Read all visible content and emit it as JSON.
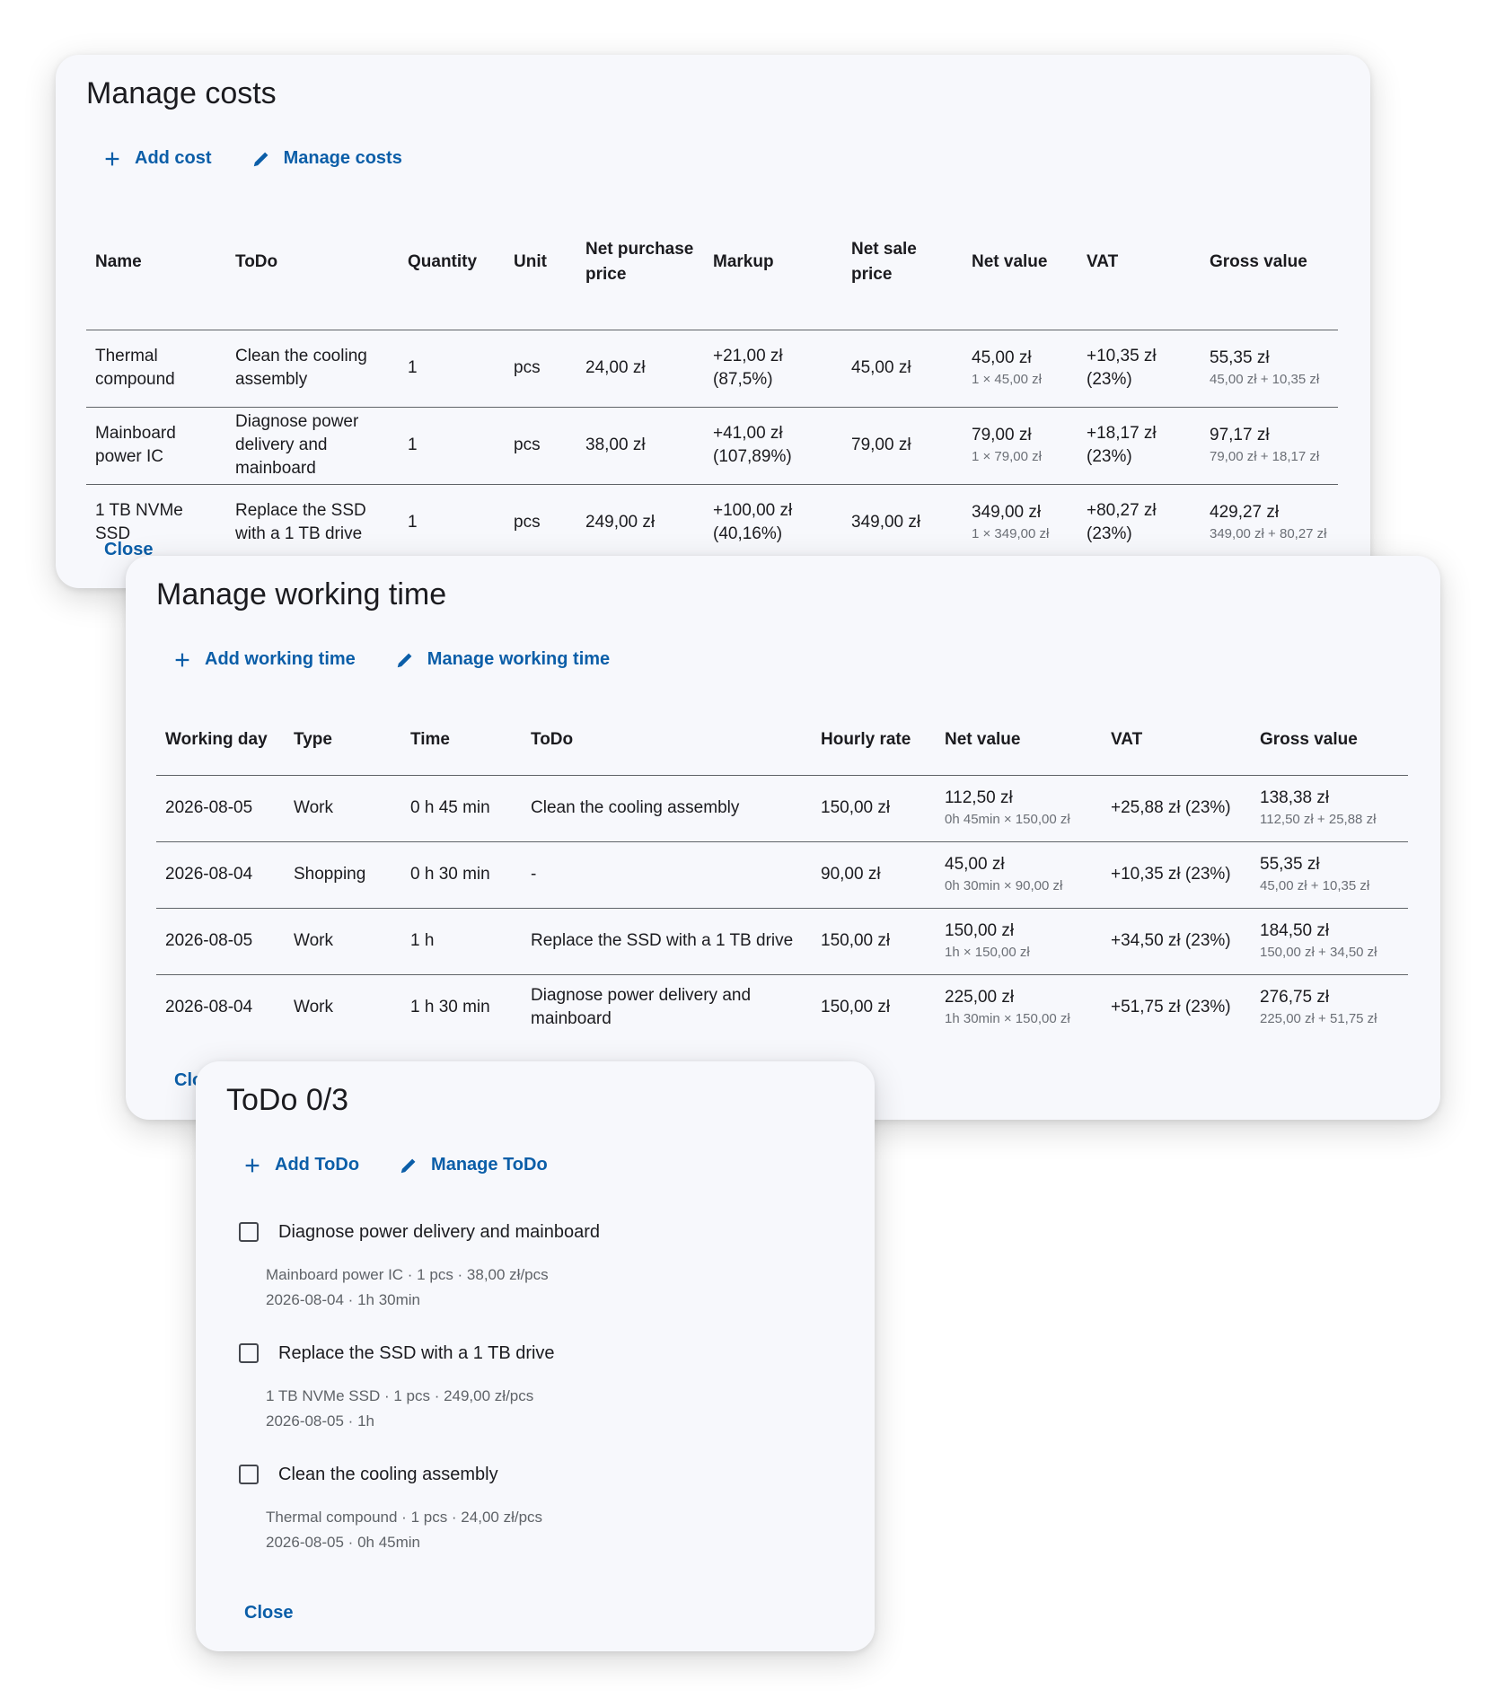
{
  "costs_dialog": {
    "title": "Manage costs",
    "add_label": "Add cost",
    "manage_label": "Manage costs",
    "close_label": "Close",
    "headers": [
      "Name",
      "ToDo",
      "Quantity",
      "Unit",
      "Net purchase price",
      "Markup",
      "Net sale price",
      "Net value",
      "VAT",
      "Gross value"
    ],
    "rows": [
      {
        "name": "Thermal compound",
        "todo": "Clean the cooling assembly",
        "quantity": "1",
        "unit": "pcs",
        "net_purchase": "24,00 zł",
        "markup": "+21,00 zł (87,5%)",
        "net_sale": "45,00 zł",
        "net_value": "45,00 zł",
        "net_value_sub": "1 × 45,00 zł",
        "vat": "+10,35 zł (23%)",
        "gross_value": "55,35 zł",
        "gross_value_sub": "45,00 zł + 10,35 zł"
      },
      {
        "name": "Mainboard power IC",
        "todo": "Diagnose power delivery and mainboard",
        "quantity": "1",
        "unit": "pcs",
        "net_purchase": "38,00 zł",
        "markup": "+41,00 zł (107,89%)",
        "net_sale": "79,00 zł",
        "net_value": "79,00 zł",
        "net_value_sub": "1 × 79,00 zł",
        "vat": "+18,17 zł (23%)",
        "gross_value": "97,17 zł",
        "gross_value_sub": "79,00 zł + 18,17 zł"
      },
      {
        "name": "1 TB NVMe SSD",
        "todo": "Replace the SSD with a 1 TB drive",
        "quantity": "1",
        "unit": "pcs",
        "net_purchase": "249,00 zł",
        "markup": "+100,00 zł (40,16%)",
        "net_sale": "349,00 zł",
        "net_value": "349,00 zł",
        "net_value_sub": "1 × 349,00 zł",
        "vat": "+80,27 zł (23%)",
        "gross_value": "429,27 zł",
        "gross_value_sub": "349,00 zł + 80,27 zł"
      }
    ]
  },
  "time_dialog": {
    "title": "Manage working time",
    "add_label": "Add working time",
    "manage_label": "Manage working time",
    "close_label": "Close",
    "headers": [
      "Working day",
      "Type",
      "Time",
      "ToDo",
      "Hourly rate",
      "Net value",
      "VAT",
      "Gross value"
    ],
    "rows": [
      {
        "day": "2026-08-05",
        "type": "Work",
        "time": "0 h 45 min",
        "todo": "Clean the cooling assembly",
        "rate": "150,00 zł",
        "net_value": "112,50 zł",
        "net_value_sub": "0h 45min × 150,00 zł",
        "vat": "+25,88 zł (23%)",
        "gross_value": "138,38 zł",
        "gross_value_sub": "112,50 zł + 25,88 zł"
      },
      {
        "day": "2026-08-04",
        "type": "Shopping",
        "time": "0 h 30 min",
        "todo": "-",
        "rate": "90,00 zł",
        "net_value": "45,00 zł",
        "net_value_sub": "0h 30min × 90,00 zł",
        "vat": "+10,35 zł (23%)",
        "gross_value": "55,35 zł",
        "gross_value_sub": "45,00 zł + 10,35 zł"
      },
      {
        "day": "2026-08-05",
        "type": "Work",
        "time": "1 h",
        "todo": "Replace the SSD with a 1 TB drive",
        "rate": "150,00 zł",
        "net_value": "150,00 zł",
        "net_value_sub": "1h × 150,00 zł",
        "vat": "+34,50 zł (23%)",
        "gross_value": "184,50 zł",
        "gross_value_sub": "150,00 zł + 34,50 zł"
      },
      {
        "day": "2026-08-04",
        "type": "Work",
        "time": "1 h 30 min",
        "todo": "Diagnose power delivery and mainboard",
        "rate": "150,00 zł",
        "net_value": "225,00 zł",
        "net_value_sub": "1h 30min × 150,00 zł",
        "vat": "+51,75 zł (23%)",
        "gross_value": "276,75 zł",
        "gross_value_sub": "225,00 zł + 51,75 zł"
      }
    ]
  },
  "todo_dialog": {
    "title": "ToDo 0/3",
    "add_label": "Add ToDo",
    "manage_label": "Manage ToDo",
    "close_label": "Close",
    "items": [
      {
        "title": "Diagnose power delivery and mainboard",
        "meta1": "Mainboard power IC · 1 pcs · 38,00 zł/pcs",
        "meta2": "2026-08-04 · 1h 30min",
        "checked": false
      },
      {
        "title": "Replace the SSD with a 1 TB drive",
        "meta1": "1 TB NVMe SSD · 1 pcs · 249,00 zł/pcs",
        "meta2": "2026-08-05 · 1h",
        "checked": false
      },
      {
        "title": "Clean the cooling assembly",
        "meta1": "Thermal compound · 1 pcs · 24,00 zł/pcs",
        "meta2": "2026-08-05 · 0h 45min",
        "checked": false
      }
    ]
  },
  "icons": {
    "add": "plus-icon",
    "manage": "pencil-icon"
  },
  "colors": {
    "accent": "#0b5ea8",
    "surface": "#f7f8fc",
    "text": "#1b1b1f",
    "muted": "#6b6f76"
  }
}
